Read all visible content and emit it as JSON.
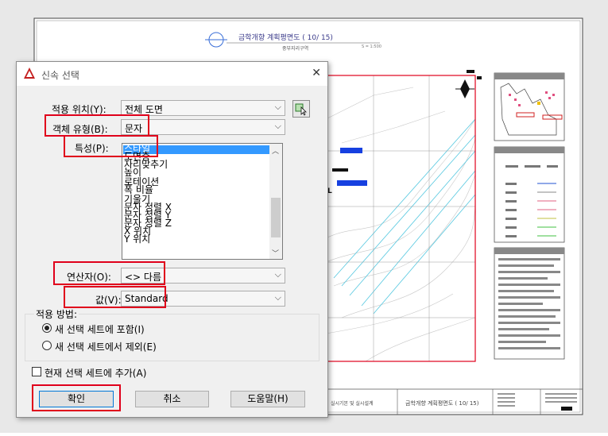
{
  "drawing": {
    "title_main": "금학개향 계획평면도 ( 10/ 15)",
    "title_sub": "중부지리구역",
    "title_scale": "S = 1:500",
    "bottom_block_text": "금학개향 계획평면도 ( 10/ 15)",
    "bottom_left_text": "실시기본 및 실시설계",
    "map_label": "L"
  },
  "dialog": {
    "title": "신속 선택",
    "close_label": "✕",
    "apply_to": {
      "label": "적용 위치(Y):",
      "value": "전체 도면"
    },
    "object_type": {
      "label": "객체 유형(B):",
      "value": "문자"
    },
    "properties": {
      "label": "특성(P):",
      "items": [
        "스타일",
        "도면층",
        "자리맞추기",
        "높이",
        "로테이션",
        "폭 비율",
        "기울기",
        "문자 정렬 X",
        "문자 정렬 Y",
        "문자 정렬 Z",
        "X 위치",
        "Y 위치"
      ],
      "selected_index": 0
    },
    "operator": {
      "label": "연산자(O):",
      "value": "<> 다름"
    },
    "value": {
      "label": "값(V):",
      "value": "Standard"
    },
    "apply_how": {
      "label": "적용 방법:",
      "include": "새 선택 세트에 포함(I)",
      "exclude": "새 선택 세트에서 제외(E)",
      "selected": "include"
    },
    "append": {
      "label": "현재 선택 세트에 추가(A)",
      "checked": false
    },
    "buttons": {
      "ok": "확인",
      "cancel": "취소",
      "help": "도움말(H)"
    }
  },
  "colors": {
    "highlight_red": "#e0001b",
    "selection_blue": "#3399ff",
    "cad_logo_red": "#c41e1e"
  }
}
